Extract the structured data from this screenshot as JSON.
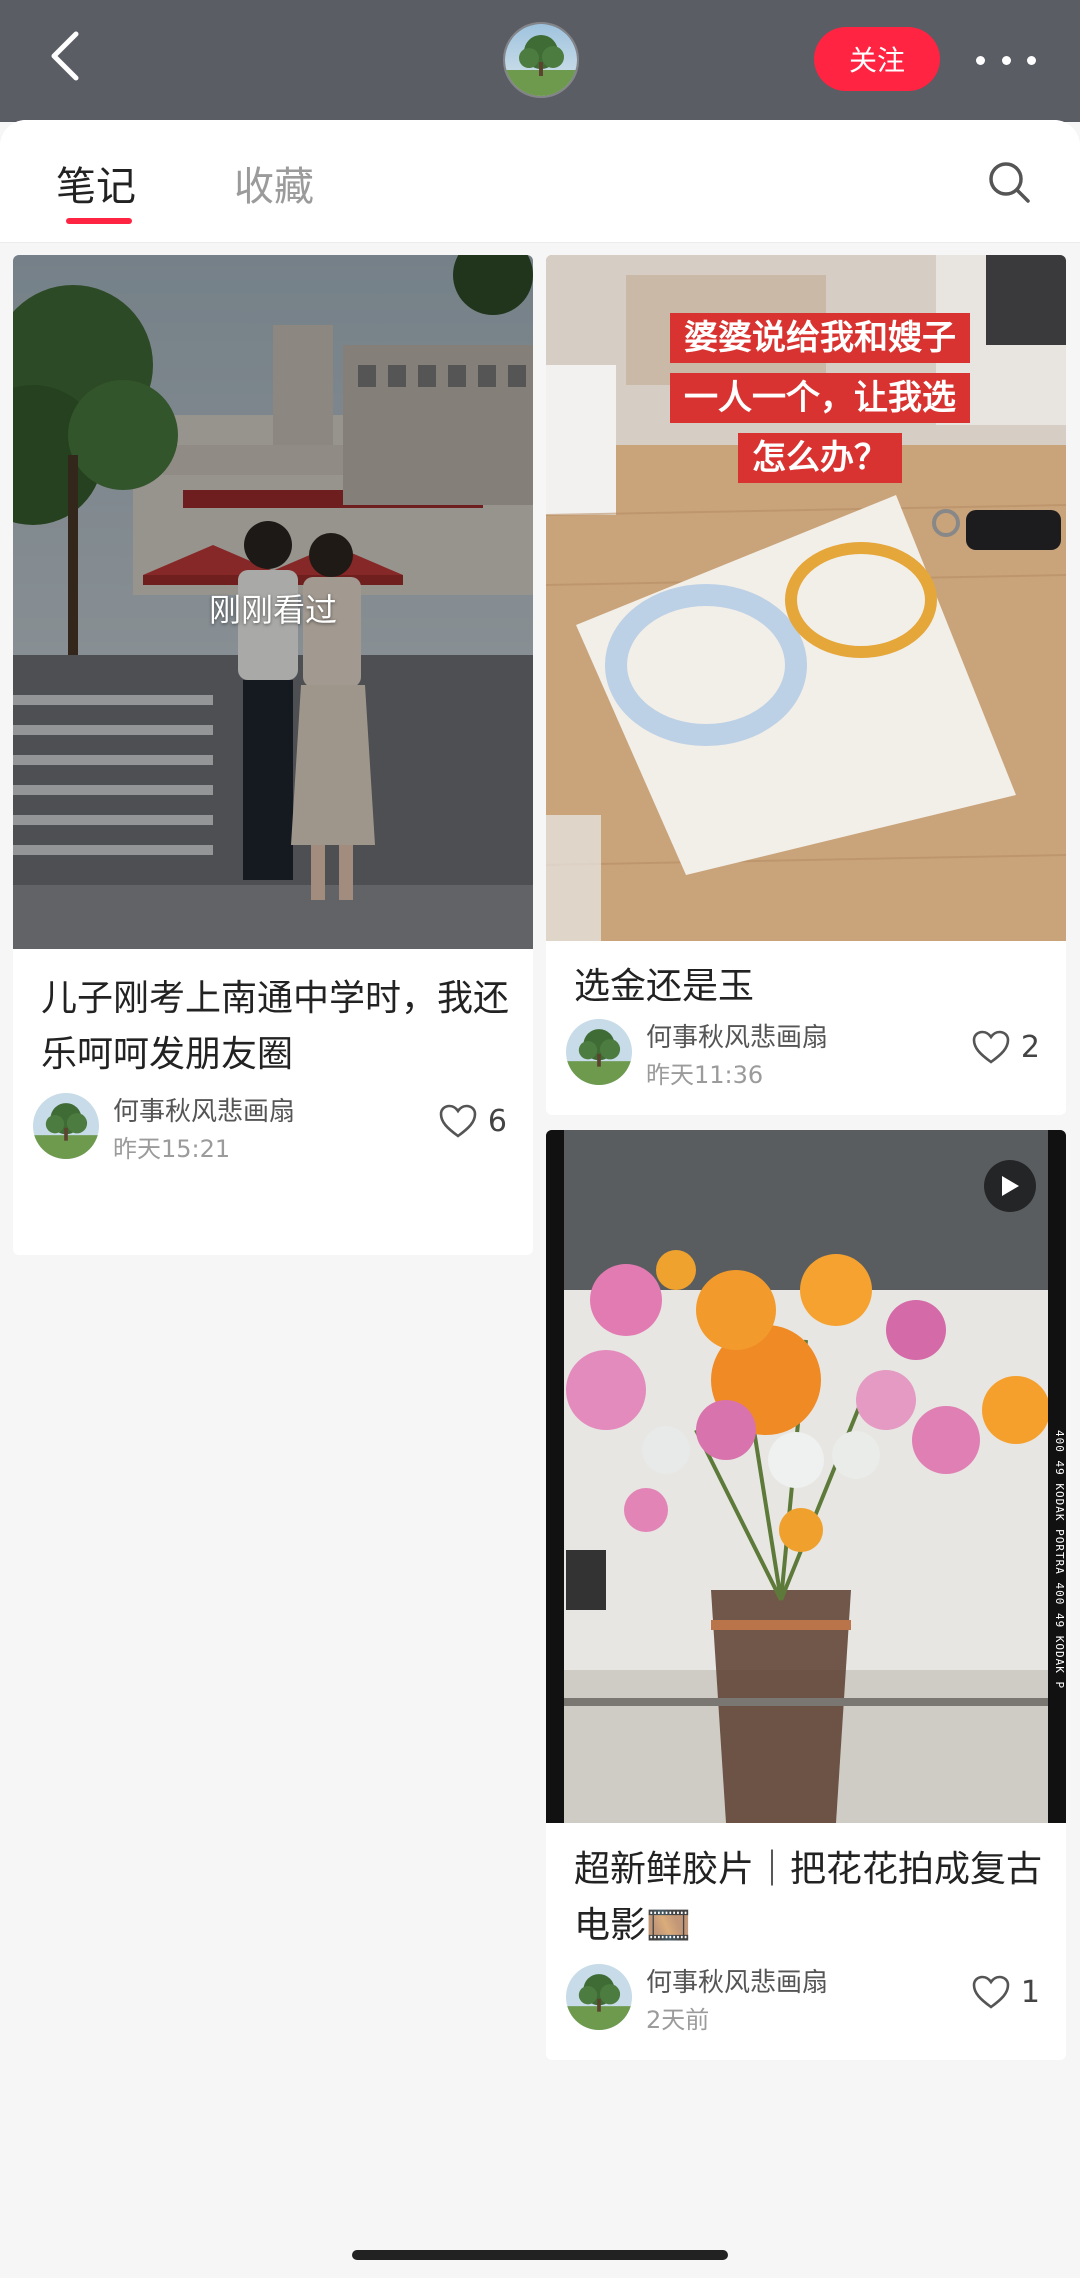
{
  "header": {
    "follow_label": "关注",
    "icons": {
      "back": "chevron-left-icon",
      "more": "more-icon"
    }
  },
  "tabs": [
    {
      "label": "笔记",
      "active": true
    },
    {
      "label": "收藏",
      "active": false
    }
  ],
  "notes": [
    {
      "title": "儿子刚考上南通中学时，我还乐呵呵发朋友圈",
      "author": "何事秋风悲画扇",
      "time": "昨天15:21",
      "likes": "6",
      "seen_label": "刚刚看过"
    },
    {
      "title": "选金还是玉",
      "author": "何事秋风悲画扇",
      "time": "昨天11:36",
      "likes": "2",
      "overlay_lines": [
        "婆婆说给我和嫂子",
        "一人一个，让我选",
        "怎么办？"
      ]
    },
    {
      "title": "超新鲜胶片｜把花花拍成复古电影🎞️",
      "author": "何事秋风悲画扇",
      "time": "2天前",
      "likes": "1",
      "film_label": "400  49  KODAK PORTRA 400  49  KODAK P"
    }
  ],
  "colors": {
    "accent": "#ff2442",
    "topbar": "#5a5d63"
  }
}
